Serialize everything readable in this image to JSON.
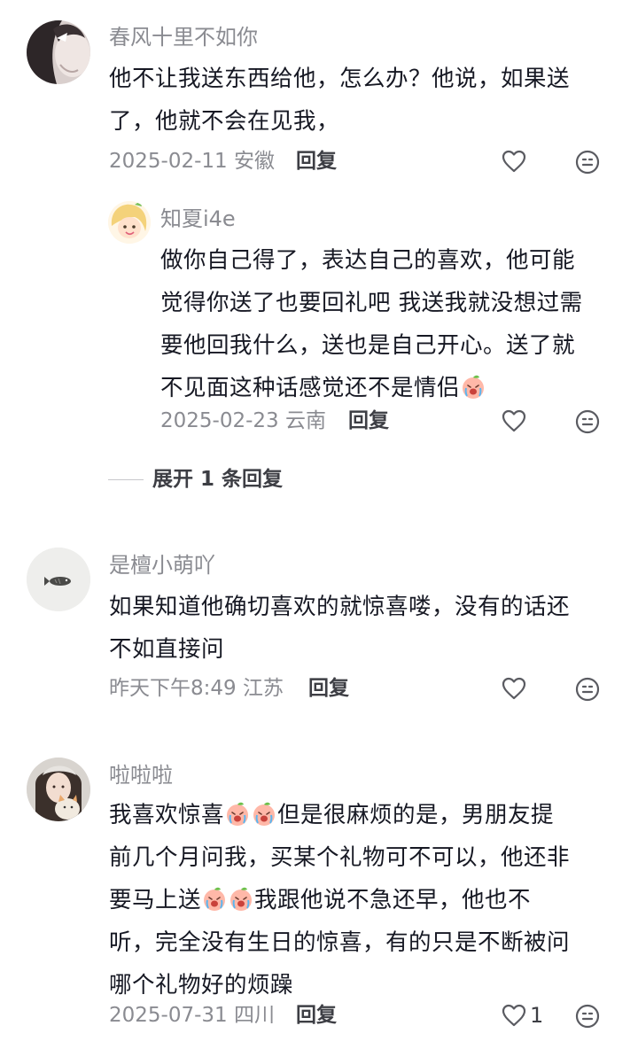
{
  "comments": [
    {
      "username": "春风十里不如你",
      "lines": [
        "他不让我送东西给他，怎么办？他说，如果送",
        "了，他就不会在见我，"
      ],
      "date": "2025-02-11",
      "location": "安徽",
      "reply_label": "回复",
      "avatar_icon": "woman-portrait-avatar",
      "reply": {
        "username": "知夏i4e",
        "lines": [
          "做你自己得了，表达自己的喜欢，他可能",
          "觉得你送了也要回礼吧 我送我就没想过需",
          "要他回我什么，送也是自己开心。送了就",
          "不见面这种话感觉还不是情侣"
        ],
        "inline_emoji": "crying-peach-emoji",
        "date": "2025-02-23",
        "location": "云南",
        "reply_label": "回复",
        "avatar_icon": "cartoon-girl-avatar"
      },
      "expand_label": "展开 1 条回复"
    },
    {
      "username": "是檀小萌吖",
      "lines": [
        "如果知道他确切喜欢的就惊喜喽，没有的话还",
        "不如直接问"
      ],
      "date": "昨天下午8:49",
      "location": "江苏",
      "reply_label": "回复",
      "avatar_icon": "small-fish-avatar"
    },
    {
      "username": "啦啦啦",
      "line1_a": "我喜欢惊喜",
      "line1_b": "但是很麻烦的是，男朋友提",
      "line2": "前几个月问我，买某个礼物可不可以，他还非",
      "line3_a": "要马上送",
      "line3_b": "我跟他说不急还早，他也不",
      "line4": "听，完全没有生日的惊喜，有的只是不断被问",
      "line5": "哪个礼物好的烦躁",
      "inline_emoji": "crying-peach-emoji",
      "date": "2025-07-31",
      "location": "四川",
      "reply_label": "回复",
      "like_count": "1",
      "avatar_icon": "girl-with-cat-avatar"
    }
  ],
  "colors": {
    "text": "#161823",
    "secondary": "#8a8b91",
    "action": "#3d3e44"
  }
}
